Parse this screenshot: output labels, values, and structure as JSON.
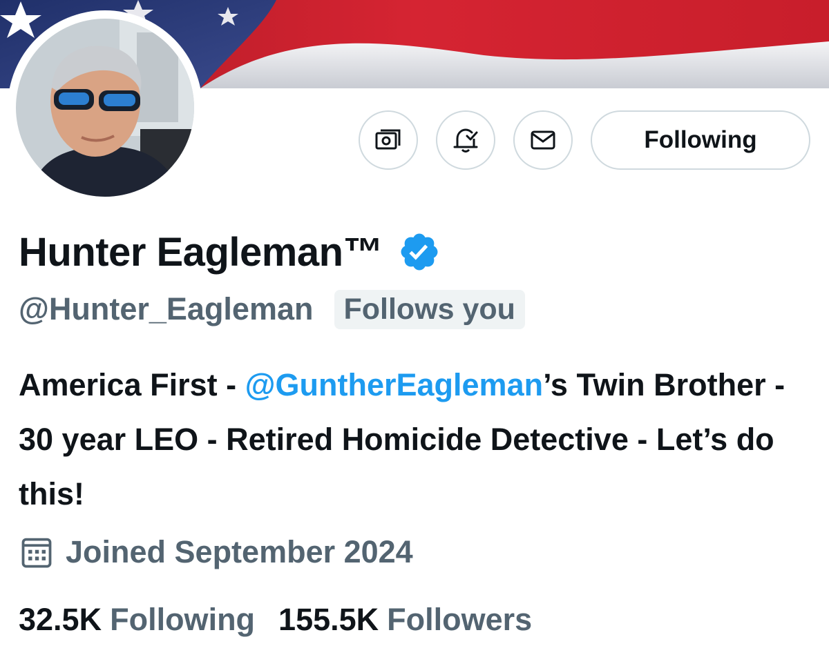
{
  "profile": {
    "display_name": "Hunter Eagleman™",
    "handle": "@Hunter_Eagleman",
    "follows_you_label": "Follows you",
    "verified": true
  },
  "actions": {
    "follow_label": "Following",
    "tip_icon": "money-icon",
    "notify_icon": "bell-check-icon",
    "message_icon": "envelope-icon"
  },
  "bio": {
    "part1": "America First - ",
    "mention": "@GuntherEagleman",
    "part2": "’s Twin Brother - 30 year LEO - Retired Homicide Detective - Let’s do this!"
  },
  "joined": {
    "icon": "calendar-icon",
    "text": "Joined September 2024"
  },
  "stats": {
    "following_count": "32.5K",
    "following_label": "Following",
    "followers_count": "155.5K",
    "followers_label": "Followers"
  },
  "colors": {
    "text": "#0f1419",
    "secondary": "#536471",
    "link": "#1d9bf0",
    "border": "#cfd9de"
  }
}
